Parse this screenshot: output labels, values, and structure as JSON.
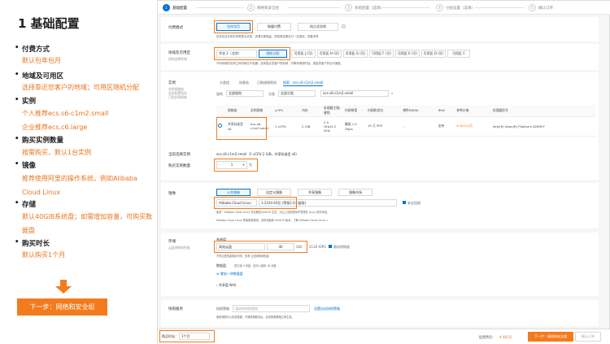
{
  "left": {
    "title": "1 基础配置",
    "items": [
      {
        "label": "付费方式",
        "desc": "默认包年包月"
      },
      {
        "label": "地域及可用区",
        "desc": "选择靠近您客户的地域；可用区随机分配"
      },
      {
        "label": "实例",
        "desc": "个人推荐ecs.s6-c1m2.small\n企业推荐ecs.c6.large"
      },
      {
        "label": "购买实例数量",
        "desc": "按需购买，默认1台实例"
      },
      {
        "label": "镜像",
        "desc": "推荐使用阿里的操作系统，例如Alibaba Cloud Linux"
      },
      {
        "label": "存储",
        "desc": "默认40GiB系统盘；如需增加容量，可购买数据盘"
      },
      {
        "label": "购买时长",
        "desc": "默认购买1个月"
      }
    ],
    "next_label": "下一步：网络和安全组"
  },
  "steps": [
    "基础配置",
    "网络和安全组",
    "系统配置（选填）",
    "分组设置（选填）",
    "确认订单"
  ],
  "billing": {
    "label": "付费模式",
    "options": [
      "包年包月",
      "按量付费",
      "抢占式实例"
    ],
    "selected": "包年包月",
    "hint": "包年包月实例可享受更大优惠，资源长期保留，提前释放需支付一定费用。查看详情"
  },
  "region": {
    "label": "地域及可用区",
    "sub": "如何选择地域",
    "region_value": "华北 2（北京）",
    "random": "随机分配",
    "zones": [
      "可用区 J (可)",
      "可用区 H (可)",
      "可用区 G (可)",
      "可用区 F (可)",
      "可用区 E (可)",
      "可用区 D (可)",
      "可用区 C"
    ],
    "hint": "不同地域的实例之间内网互不相通；选择靠近您客户的地域，可降低网络时延、提高您客户的访问速度。"
  },
  "instance": {
    "label": "实例",
    "subs": [
      "实例规格族",
      "选型配置指导",
      "已购实例规格"
    ],
    "tabs": [
      "分类找",
      "场景选",
      "已购规格帮找",
      "搜索：ecs.s6-c1m2.small"
    ],
    "filters": [
      "架构",
      "全部架构",
      "分类",
      "全部分类"
    ],
    "search_value": "ecs.s6-c1m2.small",
    "headers": [
      "规格族",
      "实例规格",
      "vCPU",
      "内存",
      "处理器主频/睿频",
      "内网带宽",
      "内网收发包",
      "弹性RDMA",
      "IPv6",
      "参考价格",
      "处理器型号"
    ],
    "row": [
      "共享标准型 s6",
      "ecs.s6-c1m2.small",
      "1 vCPU",
      "2 GiB",
      "2.5 GHz/3.2 GHz",
      "最高 1.5 Gbps",
      "15 万 PPS",
      "-",
      "支持",
      "¥ 48.02/月",
      "Intel(R) Xeon(R) Platinum 8269CY"
    ],
    "selected_label": "当前选择实例",
    "selected_value": "ecs.s6-c1m2.small（1 vCPU 2 GiB，共享标准型 s6）",
    "count_label": "购买实例数量",
    "count_value": "1",
    "count_unit": "台"
  },
  "image": {
    "label": "镜像",
    "tabs": [
      "公共镜像",
      "自定义镜像",
      "共享镜像",
      "镜像市场"
    ],
    "os": "Alibaba Cloud Linux",
    "version": "3.2104 64位 (等保2.0三级版)",
    "security": "安全加固",
    "hint1": "免费：Alibaba Cloud Linux 完全兼容CentOS 生态，为云上应用程序环境提供 Linux 操作系统。",
    "hint2": "Alibaba Cloud Linux 镜像按需使用，发布到最新 CentOS 版本。了解 Alibaba Cloud Linux >"
  },
  "storage": {
    "label": "存储",
    "sub": "云盘参数和性能",
    "sys_label": "系统盘",
    "disk_type": "高效云盘",
    "size": "40",
    "unit": "GiB",
    "iops": "2120 IOPS",
    "release": "随实例释放",
    "hint": "不同云盘性能指标不同，查看 云盘参数和性能",
    "data_label": "数据盘",
    "data_hint": "您已选 0 块盘，还可以选择 16 块盘",
    "add": "增加一块数据盘",
    "nas": "共享盘 NAS"
  },
  "snapshot": {
    "label": "快照服务",
    "policy": "快照策略",
    "policy_ph": "请选择快照策略",
    "link": "设置自动快照策略",
    "hint": "使用快照可以恢复数据，开通快照服务后，自动快照策略立即生效。"
  },
  "footer": {
    "duration_label": "购买时长：",
    "duration_value": "1个月",
    "price_label": "配置费用：",
    "price": "¥ 48.02",
    "next": "下一步：网络和安全组",
    "confirm": "确认订单"
  }
}
